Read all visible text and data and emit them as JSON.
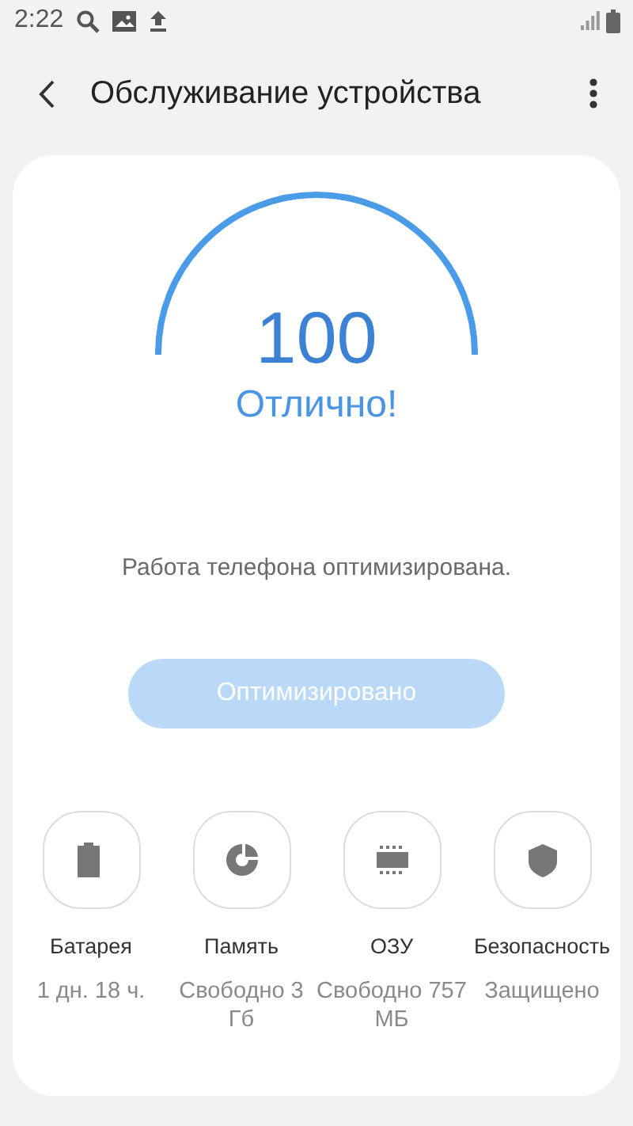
{
  "status_bar": {
    "time": "2:22"
  },
  "header": {
    "title": "Обслуживание устройства"
  },
  "score": {
    "value": "100",
    "label": "Отлично!"
  },
  "message": "Работа телефона оптимизирована.",
  "optimize_button": {
    "label": "Оптимизировано",
    "disabled": true
  },
  "tiles": [
    {
      "kind": "battery",
      "label": "Батарея",
      "value": "1 дн. 18 ч."
    },
    {
      "kind": "storage",
      "label": "Память",
      "value": "Свободно 3 Гб"
    },
    {
      "kind": "memory",
      "label": "ОЗУ",
      "value": "Свободно 757 МБ"
    },
    {
      "kind": "security",
      "label": "Безопасность",
      "value": "Защищено"
    }
  ]
}
